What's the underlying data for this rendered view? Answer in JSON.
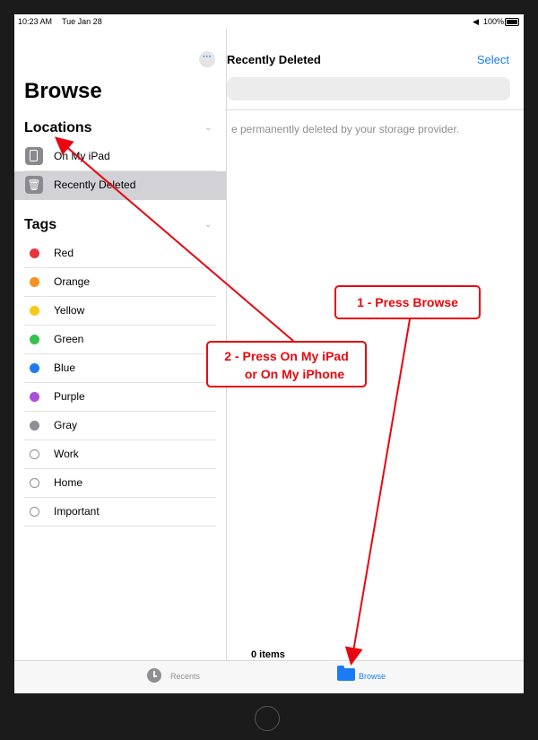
{
  "status": {
    "time": "10:23 AM",
    "date": "Tue Jan 28",
    "battery": "100%"
  },
  "main": {
    "title": "Recently Deleted",
    "select_label": "Select",
    "message": "e permanently deleted by your storage provider.",
    "item_count": "0 items"
  },
  "sidebar": {
    "more_label": "···",
    "title": "Browse",
    "locations_heading": "Locations",
    "locations": [
      {
        "label": "On My iPad",
        "icon": "ipad-icon",
        "selected": false
      },
      {
        "label": "Recently Deleted",
        "icon": "trash-icon",
        "selected": true
      }
    ],
    "tags_heading": "Tags",
    "tags": [
      {
        "label": "Red",
        "color": "#e8343f"
      },
      {
        "label": "Orange",
        "color": "#f7901e"
      },
      {
        "label": "Yellow",
        "color": "#f8c91b"
      },
      {
        "label": "Green",
        "color": "#34c24c"
      },
      {
        "label": "Blue",
        "color": "#1b7cf5"
      },
      {
        "label": "Purple",
        "color": "#a94fdc"
      },
      {
        "label": "Gray",
        "color": "#8e8e93"
      },
      {
        "label": "Work",
        "color": "none"
      },
      {
        "label": "Home",
        "color": "none"
      },
      {
        "label": "Important",
        "color": "none"
      }
    ]
  },
  "tabbar": {
    "recents_label": "Recents",
    "browse_label": "Browse",
    "active": "Browse"
  },
  "annotations": {
    "callout1": "1 - Press Browse",
    "callout2_line1": "2 - Press On My iPad",
    "callout2_line2": "or On My iPhone",
    "color": "#e8070f"
  }
}
